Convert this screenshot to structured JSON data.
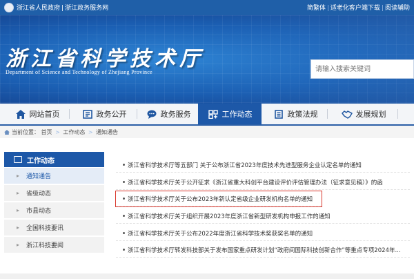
{
  "topbar": {
    "left_links": [
      "浙江省人民政府",
      "浙江政务服务网"
    ],
    "right_links": [
      "简繁体",
      "适老化客户端下载",
      "阅读辅助"
    ]
  },
  "banner": {
    "title_cn": "浙江省科学技术厅",
    "title_en": "Department of Science and Technology of Zhejiang Province"
  },
  "search": {
    "placeholder": "请输入搜索关键词"
  },
  "nav": {
    "items": [
      {
        "label": "网站首页",
        "icon": "home-icon"
      },
      {
        "label": "政务公开",
        "icon": "document-icon"
      },
      {
        "label": "政务服务",
        "icon": "chat-icon"
      },
      {
        "label": "工作动态",
        "icon": "grid-icon",
        "active": true
      },
      {
        "label": "政策法规",
        "icon": "book-icon"
      },
      {
        "label": "发展规划",
        "icon": "handshake-icon"
      }
    ]
  },
  "breadcrumb": {
    "prefix": "当前位置：",
    "items": [
      "首页",
      "工作动态",
      "通知通告"
    ]
  },
  "sidebar": {
    "heading": "工作动态",
    "items": [
      {
        "label": "通知通告",
        "active": true
      },
      {
        "label": "省级动态"
      },
      {
        "label": "市县动态"
      },
      {
        "label": "全国科技要讯"
      },
      {
        "label": "浙江科技要闻"
      }
    ]
  },
  "list": [
    "浙江省科学技术厅等五部门 关于公布浙江省2023年度技术先进型服务企业认定名单的通知",
    "浙江省科学技术厅关于公开征求《浙江省重大科创平台建设评价评估管理办法（征求意见稿）》的函",
    "浙江省科学技术厅关于公布2023年新认定省级企业研发机构名单的通知",
    "浙江省科学技术厅关于组织开展2023年度浙江省新型研发机构申报工作的通知",
    "浙江省科学技术厅关于公布2022年度浙江省科学技术奖获奖名单的通知",
    "浙江省科学技术厅转发科技部关于发布国家重点研发计划“政府间国际科技创新合作”等重点专项2024年..."
  ],
  "colors": {
    "primary": "#1d58a8",
    "topbar": "#1f5fa8",
    "highlight": "#d9362b"
  }
}
